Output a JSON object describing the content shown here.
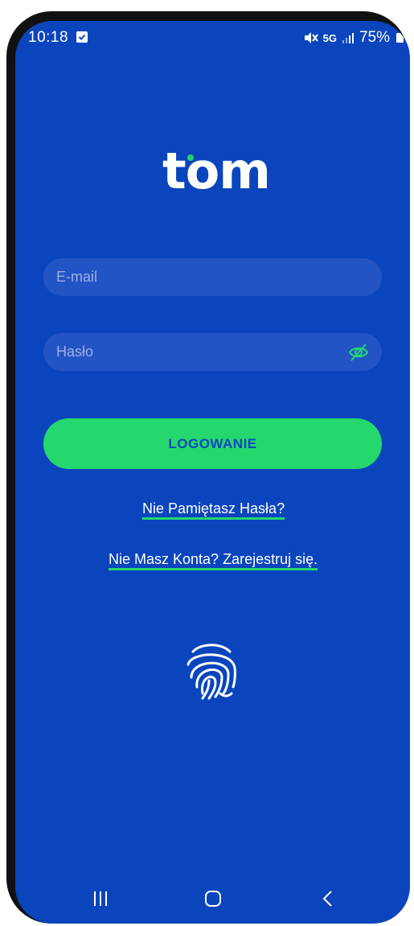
{
  "status_bar": {
    "time": "10:18",
    "battery": "75%",
    "network": "5G"
  },
  "app": {
    "logo_text": "tom"
  },
  "form": {
    "email_placeholder": "E-mail",
    "password_placeholder": "Hasło",
    "login_label": "LOGOWANIE",
    "forgot_password_link": "Nie Pamiętasz Hasła?",
    "register_link": "Nie Masz Konta? Zarejestruj się."
  },
  "colors": {
    "background": "#0b45bd",
    "accent": "#25d86d",
    "field": "#2254c6"
  },
  "icons": {
    "eye": "eye-slash-icon",
    "fingerprint": "fingerprint-icon",
    "recent_apps": "recent-apps-icon",
    "home": "home-icon",
    "back": "back-icon"
  }
}
